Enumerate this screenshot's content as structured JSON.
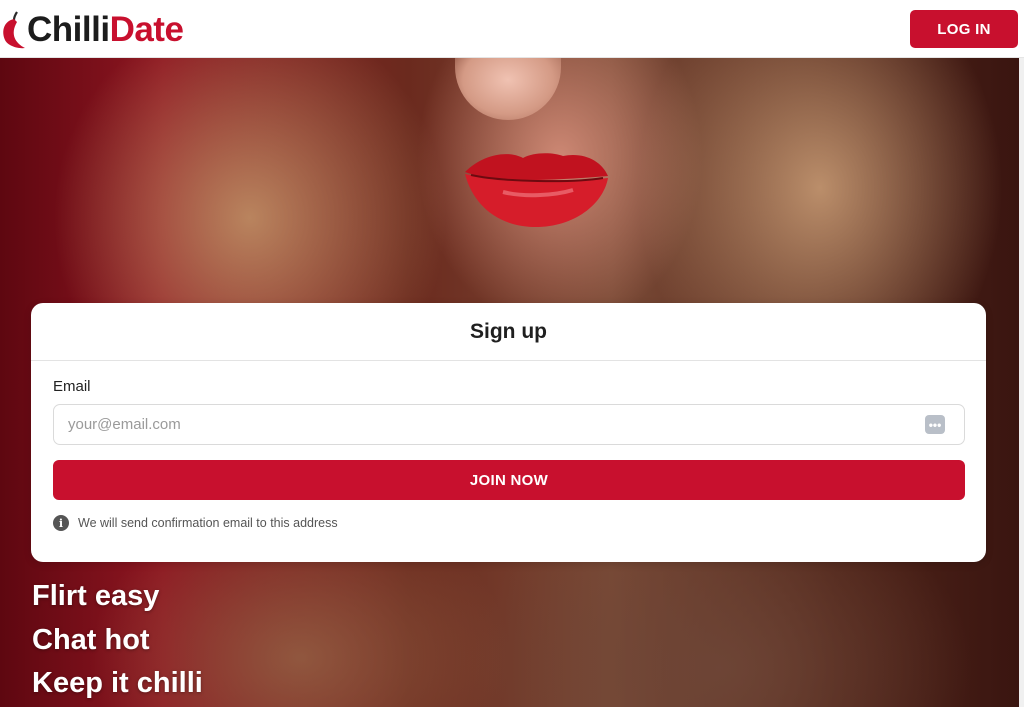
{
  "header": {
    "logo_part1": "Chilli",
    "logo_part2": "Date",
    "login_label": "LOG IN"
  },
  "signup": {
    "title": "Sign up",
    "email_label": "Email",
    "email_placeholder": "your@email.com",
    "email_value": "",
    "join_label": "JOIN NOW",
    "info_text": "We will send confirmation email to this address"
  },
  "taglines": [
    "Flirt easy",
    "Chat hot",
    "Keep it chilli"
  ],
  "colors": {
    "brand_red": "#c8102e",
    "dark_text": "#1c1c1c"
  },
  "icons": {
    "logo": "chilli-pepper-icon",
    "autofill": "password-manager-icon",
    "info": "info-icon"
  }
}
